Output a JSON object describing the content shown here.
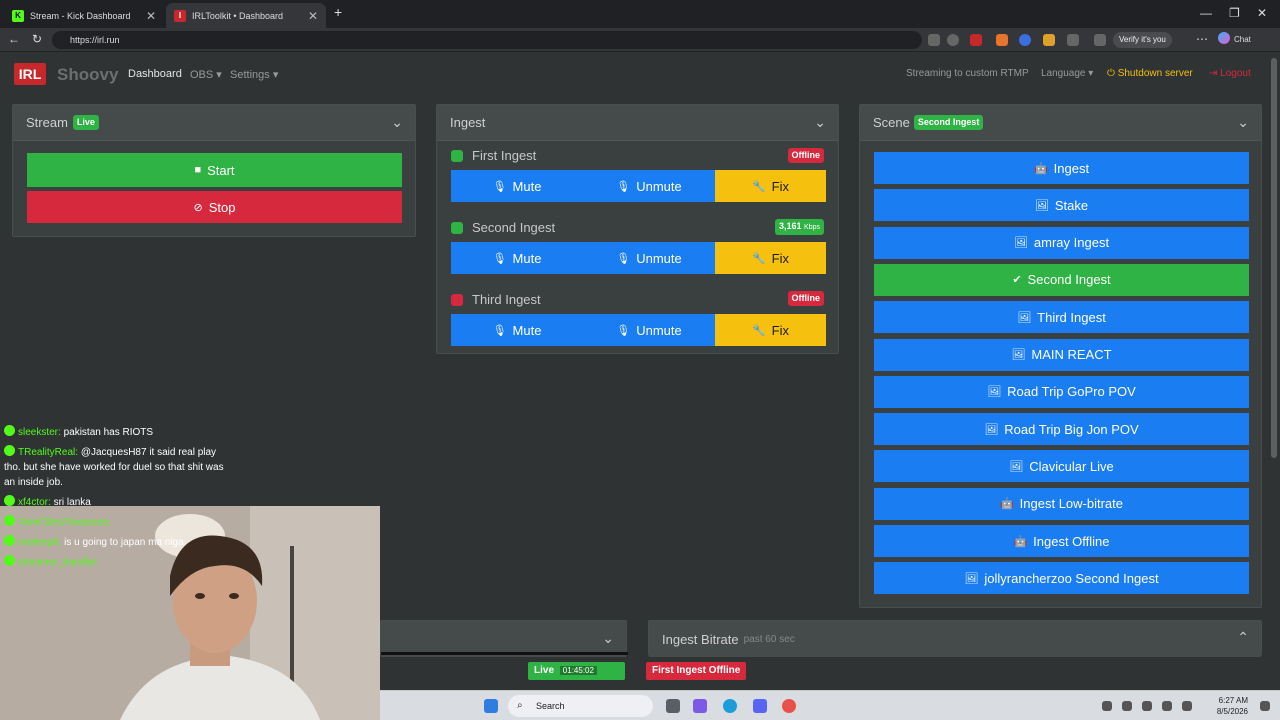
{
  "browser": {
    "tabs": [
      {
        "title": "Stream - Kick Dashboard",
        "active": false
      },
      {
        "title": "IRLToolkit • Dashboard",
        "active": true
      }
    ],
    "url": "https://irl.run",
    "verify_label": "Verify it's you",
    "chat_label": "Chat"
  },
  "nav": {
    "logo": "IRL",
    "brand": "Shoovy",
    "dashboard": "Dashboard",
    "obs": "OBS",
    "settings": "Settings",
    "streaming_status": "Streaming to custom RTMP",
    "language": "Language",
    "shutdown": "Shutdown server",
    "logout": "Logout"
  },
  "stream_panel": {
    "title": "Stream",
    "badge": "Live",
    "start": "Start",
    "stop": "Stop"
  },
  "ingest_panel": {
    "title": "Ingest",
    "items": [
      {
        "name": "First Ingest",
        "status": "Offline",
        "status_color": "#d6293e"
      },
      {
        "name": "Second Ingest",
        "status": "3,161",
        "status_unit": "Kbps",
        "status_color": "#2fb344"
      },
      {
        "name": "Third Ingest",
        "status": "Offline",
        "status_color": "#d6293e"
      }
    ],
    "mute": "Mute",
    "unmute": "Unmute",
    "fix": "Fix"
  },
  "scene_panel": {
    "title": "Scene",
    "badge": "Second Ingest",
    "scenes": [
      {
        "label": "Ingest",
        "icon": "robot-icon",
        "active": false
      },
      {
        "label": "Stake",
        "icon": "image-icon",
        "active": false
      },
      {
        "label": "amray Ingest",
        "icon": "image-icon",
        "active": false
      },
      {
        "label": "Second Ingest",
        "icon": "check-icon",
        "active": true
      },
      {
        "label": "Third Ingest",
        "icon": "image-icon",
        "active": false
      },
      {
        "label": "MAIN REACT",
        "icon": "image-icon",
        "active": false
      },
      {
        "label": "Road Trip GoPro POV",
        "icon": "image-icon",
        "active": false
      },
      {
        "label": "Road Trip Big Jon POV",
        "icon": "image-icon",
        "active": false
      },
      {
        "label": "Clavicular Live",
        "icon": "image-icon",
        "active": false
      },
      {
        "label": "Ingest Low-bitrate",
        "icon": "robot-icon",
        "active": false
      },
      {
        "label": "Ingest Offline",
        "icon": "robot-icon",
        "active": false
      },
      {
        "label": "jollyrancherzoo Second Ingest",
        "icon": "image-icon",
        "active": false
      }
    ]
  },
  "bitrate_panel": {
    "title": "Ingest Bitrate",
    "subtitle": "past 60 sec"
  },
  "status_bar": {
    "live_label": "Live",
    "live_time": "01:45:02",
    "ingest_status": "First Ingest Offline"
  },
  "chat": [
    {
      "user": "sleekster:",
      "message": "pakistan has RIOTS"
    },
    {
      "user": "TRealityReal:",
      "message": "@JacquesH87 it said real play tho. but she have worked for duel so that shit was an inside job."
    },
    {
      "user": "xf4ctor:",
      "message": "sri lanka"
    },
    {
      "user": "TwinCitiesTreasures:",
      "message": ""
    },
    {
      "user": "nosleep6:",
      "message": "is u going to japan ma niga"
    },
    {
      "user": "streamer_handler:",
      "message": ""
    }
  ],
  "taskbar": {
    "search": "Search",
    "time": "6:27 AM",
    "date": "8/5/2026"
  },
  "colors": {
    "primary": "#1a7df2",
    "success": "#2fb344",
    "danger": "#d6293e",
    "warning": "#f5c00e",
    "kick_green": "#53fc18"
  }
}
